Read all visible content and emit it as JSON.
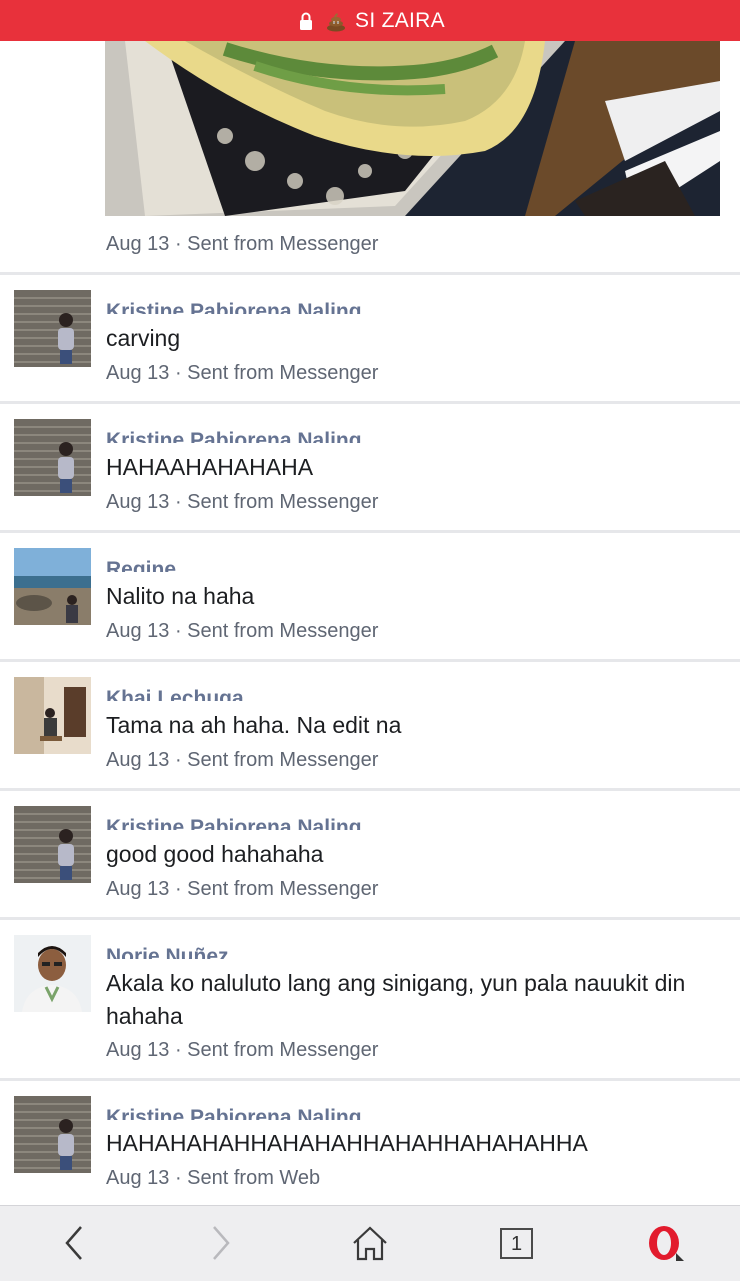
{
  "header": {
    "title": "SI ZAIRA",
    "lock_icon": "lock-icon",
    "emoji_icon": "poop-emoji-icon",
    "color": "#e8313b"
  },
  "post": {
    "meta": "Aug 13 · Sent from Messenger"
  },
  "comments": [
    {
      "name": "Kristine Pabiorena Naling",
      "text": "carving",
      "meta": "Aug 13 · Sent from Messenger",
      "avatar": "shutter-girl"
    },
    {
      "name": "Kristine Pabiorena Naling",
      "text": "HAHAAHAHAHAHA",
      "meta": "Aug 13 · Sent from Messenger",
      "avatar": "shutter-girl"
    },
    {
      "name": "Regine",
      "text": "Nalito na haha",
      "meta": "Aug 13 · Sent from Messenger",
      "avatar": "beach"
    },
    {
      "name": "Khai Lechuga",
      "text": "Tama na ah haha. Na edit na",
      "meta": "Aug 13 · Sent from Messenger",
      "avatar": "room"
    },
    {
      "name": "Kristine Pabiorena Naling",
      "text": "good good hahahaha",
      "meta": "Aug 13 · Sent from Messenger",
      "avatar": "shutter-girl"
    },
    {
      "name": "Norie Nuñez",
      "text": "Akala ko naluluto lang ang sinigang, yun pala nauukit din hahaha",
      "meta": "Aug 13 · Sent from Messenger",
      "avatar": "man"
    },
    {
      "name": "Kristine Pabiorena Naling",
      "text": "HAHAHAHAHHAHAHAHHAHAHHAHAHAHHA",
      "meta": "Aug 13 · Sent from Web",
      "avatar": "shutter-girl"
    }
  ],
  "bottom_nav": {
    "back_icon": "back-arrow-icon",
    "forward_icon": "forward-arrow-icon",
    "home_icon": "home-icon",
    "tab_count": "1",
    "opera_icon": "opera-logo-icon"
  }
}
